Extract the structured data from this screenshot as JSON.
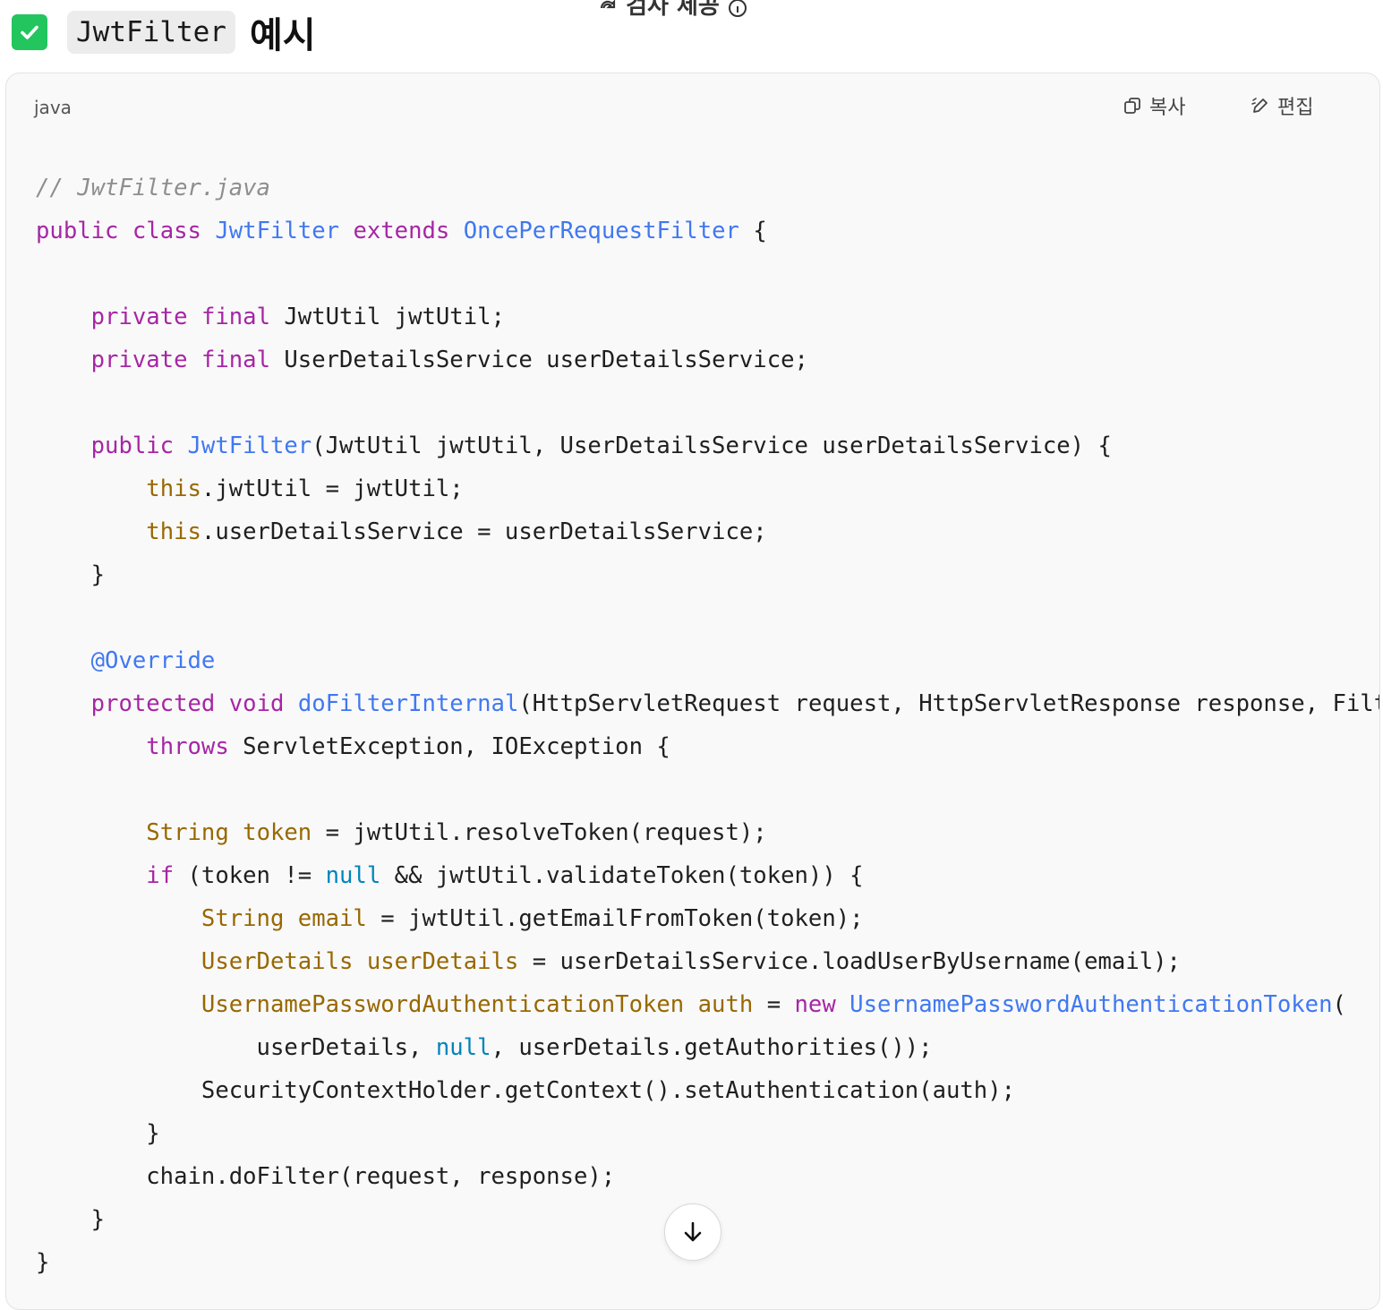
{
  "top_fragment": {
    "text": "검사 제공",
    "icon": "refresh-icon",
    "info_icon": "info-circle-icon"
  },
  "heading": {
    "check_icon": "check-square-icon",
    "code": "JwtFilter",
    "text": "예시"
  },
  "code_block": {
    "language": "java",
    "copy_label": "복사",
    "copy_icon": "copy-icon",
    "edit_label": "편집",
    "edit_icon": "pencil-icon",
    "scroll_down_icon": "arrow-down-icon",
    "lines": [
      [
        {
          "t": "// JwtFilter.java",
          "c": "comment"
        }
      ],
      [
        {
          "t": "public",
          "c": "kw"
        },
        {
          "t": " "
        },
        {
          "t": "class",
          "c": "kw"
        },
        {
          "t": " "
        },
        {
          "t": "JwtFilter",
          "c": "type"
        },
        {
          "t": " "
        },
        {
          "t": "extends",
          "c": "kw"
        },
        {
          "t": " "
        },
        {
          "t": "OncePerRequestFilter",
          "c": "type"
        },
        {
          "t": " {"
        }
      ],
      [],
      [
        {
          "t": "    "
        },
        {
          "t": "private",
          "c": "kw"
        },
        {
          "t": " "
        },
        {
          "t": "final",
          "c": "kw"
        },
        {
          "t": " JwtUtil jwtUtil;"
        }
      ],
      [
        {
          "t": "    "
        },
        {
          "t": "private",
          "c": "kw"
        },
        {
          "t": " "
        },
        {
          "t": "final",
          "c": "kw"
        },
        {
          "t": " UserDetailsService userDetailsService;"
        }
      ],
      [],
      [
        {
          "t": "    "
        },
        {
          "t": "public",
          "c": "kw"
        },
        {
          "t": " "
        },
        {
          "t": "JwtFilter",
          "c": "type"
        },
        {
          "t": "(JwtUtil jwtUtil, UserDetailsService userDetailsService) {"
        }
      ],
      [
        {
          "t": "        "
        },
        {
          "t": "this",
          "c": "this"
        },
        {
          "t": ".jwtUtil = jwtUtil;"
        }
      ],
      [
        {
          "t": "        "
        },
        {
          "t": "this",
          "c": "this"
        },
        {
          "t": ".userDetailsService = userDetailsService;"
        }
      ],
      [
        {
          "t": "    }"
        }
      ],
      [],
      [
        {
          "t": "    "
        },
        {
          "t": "@Override",
          "c": "type"
        }
      ],
      [
        {
          "t": "    "
        },
        {
          "t": "protected",
          "c": "kw"
        },
        {
          "t": " "
        },
        {
          "t": "void",
          "c": "kw"
        },
        {
          "t": " "
        },
        {
          "t": "doFilterInternal",
          "c": "type"
        },
        {
          "t": "(HttpServletRequest request, HttpServletResponse response, Filt"
        }
      ],
      [
        {
          "t": "        "
        },
        {
          "t": "throws",
          "c": "kw"
        },
        {
          "t": " ServletException, IOException {"
        }
      ],
      [],
      [
        {
          "t": "        "
        },
        {
          "t": "String",
          "c": "this"
        },
        {
          "t": " "
        },
        {
          "t": "token",
          "c": "this"
        },
        {
          "t": " = jwtUtil.resolveToken(request);"
        }
      ],
      [
        {
          "t": "        "
        },
        {
          "t": "if",
          "c": "kw"
        },
        {
          "t": " (token != "
        },
        {
          "t": "null",
          "c": "lit"
        },
        {
          "t": " && jwtUtil.validateToken(token)) {"
        }
      ],
      [
        {
          "t": "            "
        },
        {
          "t": "String",
          "c": "this"
        },
        {
          "t": " "
        },
        {
          "t": "email",
          "c": "this"
        },
        {
          "t": " = jwtUtil.getEmailFromToken(token);"
        }
      ],
      [
        {
          "t": "            "
        },
        {
          "t": "UserDetails",
          "c": "this"
        },
        {
          "t": " "
        },
        {
          "t": "userDetails",
          "c": "this"
        },
        {
          "t": " = userDetailsService.loadUserByUsername(email);"
        }
      ],
      [
        {
          "t": "            "
        },
        {
          "t": "UsernamePasswordAuthenticationToken",
          "c": "this"
        },
        {
          "t": " "
        },
        {
          "t": "auth",
          "c": "this"
        },
        {
          "t": " = "
        },
        {
          "t": "new",
          "c": "kw"
        },
        {
          "t": " "
        },
        {
          "t": "UsernamePasswordAuthenticationToken",
          "c": "type"
        },
        {
          "t": "("
        }
      ],
      [
        {
          "t": "                userDetails, "
        },
        {
          "t": "null",
          "c": "lit"
        },
        {
          "t": ", userDetails.getAuthorities());"
        }
      ],
      [
        {
          "t": "            SecurityContextHolder.getContext().setAuthentication(auth);"
        }
      ],
      [
        {
          "t": "        }"
        }
      ],
      [
        {
          "t": "        chain.doFilter(request, response);"
        }
      ],
      [
        {
          "t": "    }"
        }
      ],
      [
        {
          "t": "}"
        }
      ]
    ]
  }
}
